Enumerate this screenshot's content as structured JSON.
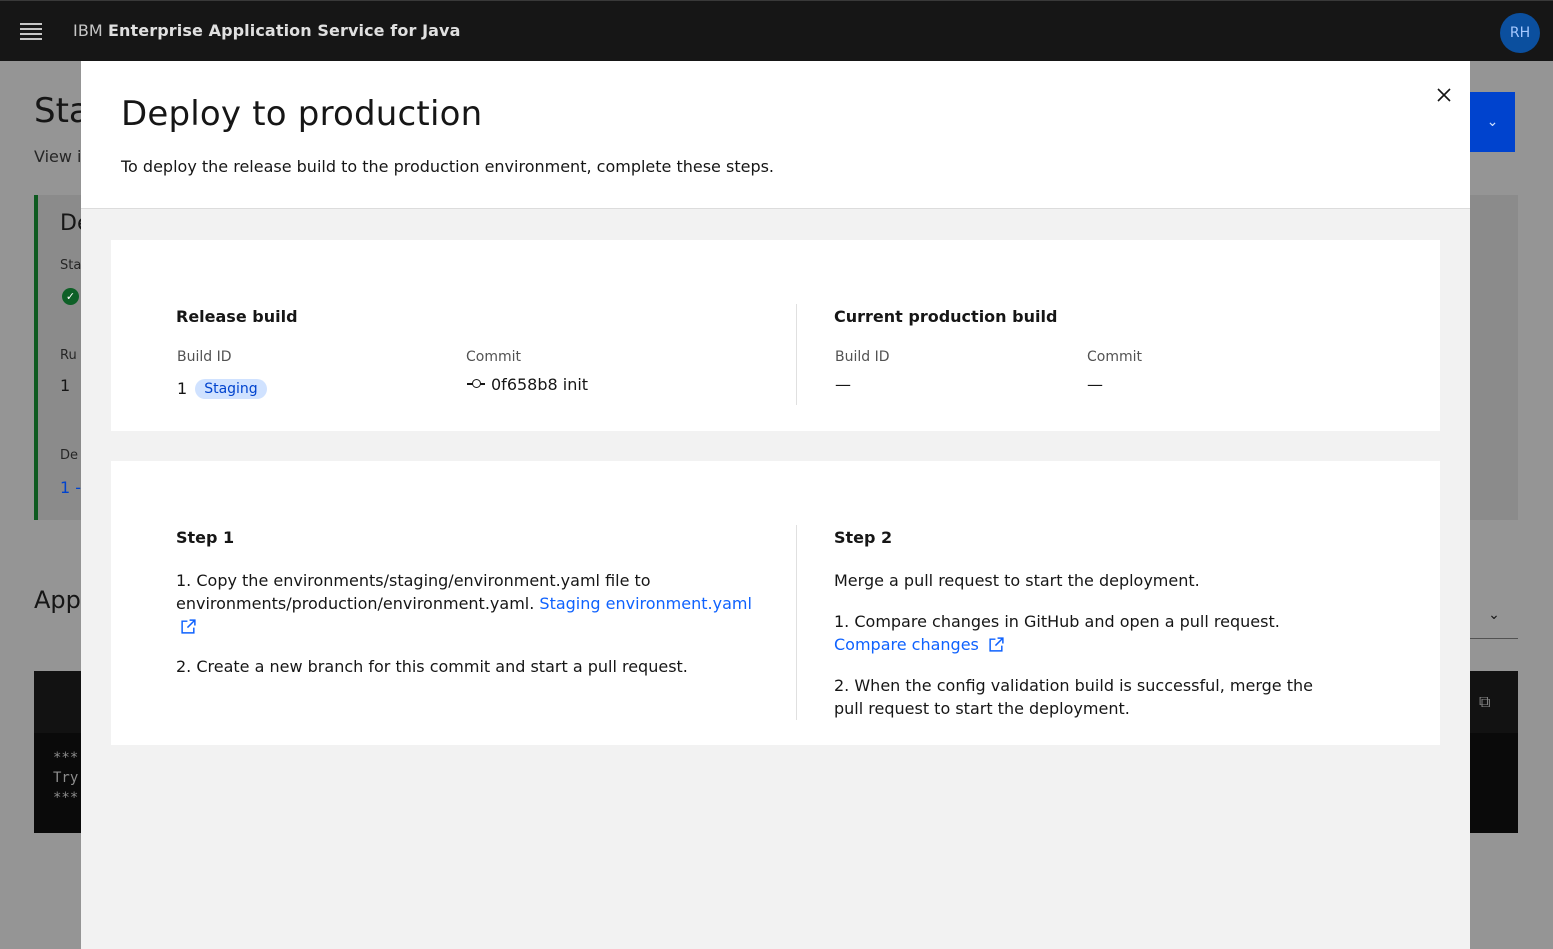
{
  "header": {
    "brand": "IBM",
    "product": "Enterprise Application Service for Java",
    "avatar_initials": "RH"
  },
  "background_page": {
    "title_fragment": "Sta",
    "subtitle_fragment": "View i",
    "card_title_fragment": "De",
    "label1_fragment": "Sta",
    "label2_fragment": "Ru",
    "value2": "1",
    "label3_fragment": "De",
    "link_fragment": "1 -",
    "section_fragment": "App",
    "terminal_lines": [
      "***",
      "Try",
      "***"
    ]
  },
  "modal": {
    "title": "Deploy to production",
    "description": "To deploy the release build to the production environment, complete these steps.",
    "release": {
      "heading": "Release build",
      "build_id_label": "Build ID",
      "build_id": "1",
      "tag": "Staging",
      "commit_label": "Commit",
      "commit": "0f658b8 init"
    },
    "production": {
      "heading": "Current production build",
      "build_id_label": "Build ID",
      "build_id": "—",
      "commit_label": "Commit",
      "commit": "—"
    },
    "step1": {
      "heading": "Step 1",
      "item1_text": "1. Copy the environments/staging/environment.yaml file to environments/production/environment.yaml.",
      "item1_link": "Staging environment.yaml",
      "item2_text": "2. Create a new branch for this commit and start a pull request."
    },
    "step2": {
      "heading": "Step 2",
      "intro": "Merge a pull request to start the deployment.",
      "item1_text": "1. Compare changes in GitHub and open a pull request.",
      "item1_link": "Compare changes",
      "item2_text": "2. When the config validation build is successful, merge the pull request to start the deployment."
    }
  },
  "colors": {
    "header_bg": "#161616",
    "link": "#0f62fe",
    "tag_bg": "#d0e2ff",
    "tag_text": "#0043ce",
    "success": "#0e6027"
  }
}
